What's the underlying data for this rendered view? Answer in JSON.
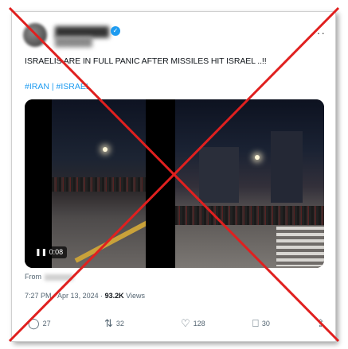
{
  "tweet": {
    "text": "ISRAELIS ARE IN FULL PANIC AFTER MISSILES HIT ISRAEL ..!!",
    "hashtags": "#IRAN | #ISRAEL",
    "video_time": "0:08",
    "from_label": "From",
    "time": "7:27 PM",
    "date": "Apr 13, 2024",
    "views_count": "93.2K",
    "views_label": "Views"
  },
  "actions": {
    "replies": "27",
    "reposts": "32",
    "likes": "128",
    "bookmarks": "30"
  },
  "colors": {
    "accent": "#1d9bf0",
    "strike": "#e0201f"
  },
  "icons": [
    "verified-icon",
    "more-icon",
    "reply-icon",
    "repost-icon",
    "like-icon",
    "bookmark-icon",
    "share-icon",
    "pause-icon"
  ]
}
